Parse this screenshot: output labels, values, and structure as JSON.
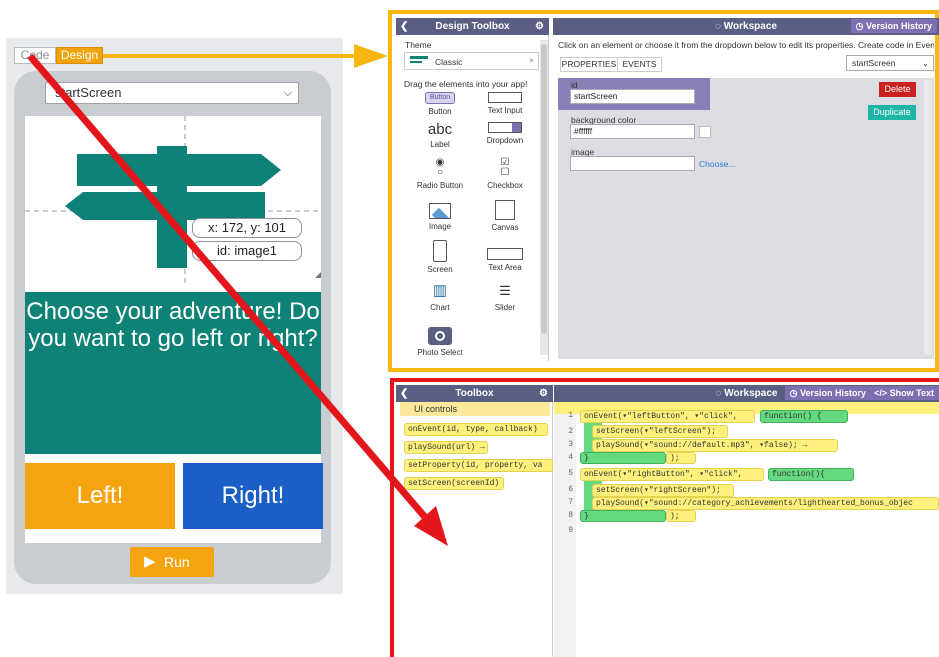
{
  "left": {
    "code_tab": "Code",
    "design_tab": "Design",
    "screen_select": "startScreen",
    "coord_readout": "x: 172, y: 101",
    "id_readout": "id: image1",
    "label_text": "Choose your adventure! Do you want to go left or right?",
    "left_button": "Left!",
    "right_button": "Right!",
    "run_button": "Run"
  },
  "design": {
    "toolbox_title": "Design Toolbox",
    "workspace_title": "Workspace",
    "version_history": "Version History",
    "theme_label": "Theme",
    "theme_value": "Classic",
    "drag_hint": "Drag the elements into your app!",
    "palette": [
      {
        "label": "Button",
        "icon": "button-icon"
      },
      {
        "label": "Text Input",
        "icon": "text-input-icon"
      },
      {
        "label": "Label",
        "icon": "label-icon"
      },
      {
        "label": "Dropdown",
        "icon": "dropdown-icon"
      },
      {
        "label": "Radio Button",
        "icon": "radio-icon"
      },
      {
        "label": "Checkbox",
        "icon": "checkbox-icon"
      },
      {
        "label": "Image",
        "icon": "image-icon"
      },
      {
        "label": "Canvas",
        "icon": "canvas-icon"
      },
      {
        "label": "Screen",
        "icon": "screen-icon"
      },
      {
        "label": "Text Area",
        "icon": "text-area-icon"
      },
      {
        "label": "Chart",
        "icon": "chart-icon"
      },
      {
        "label": "Slider",
        "icon": "slider-icon"
      },
      {
        "label": "Photo Select",
        "icon": "camera-icon"
      }
    ],
    "button_chip": "Button",
    "label_glyph": "abc",
    "instructions": "Click on an element or choose it from the dropdown below to edit its properties. Create code in Even...",
    "tab_properties": "PROPERTIES",
    "tab_events": "EVENTS",
    "element_select": "startScreen",
    "id_label": "id",
    "id_value": "startScreen",
    "bg_label": "background color",
    "bg_value": "#ffffff",
    "image_label": "image",
    "choose_link": "Choose...",
    "delete_button": "Delete",
    "duplicate_button": "Duplicate"
  },
  "code": {
    "toolbox_title": "Toolbox",
    "workspace_title": "Workspace",
    "version_history": "Version History",
    "show_text": "Show Text",
    "category": "UI controls",
    "blocks": [
      "onEvent(id, type, callback)",
      "playSound(url) →",
      "setProperty(id, property, va",
      "setScreen(screenId)"
    ],
    "line_numbers": [
      "1",
      "2",
      "3",
      "4",
      "5",
      "6",
      "7",
      "8",
      "9"
    ],
    "lines": {
      "l1a": "onEvent(▾\"leftButton\", ▾\"click\",",
      "l1b": "function() {",
      "l2": "setScreen(▾\"leftScreen\");",
      "l3": "playSound(▾\"sound://default.mp3\", ▾false); →",
      "l4a": "}",
      "l4b": ");",
      "l5a": "onEvent(▾\"rightButton\", ▾\"click\",",
      "l5b": "function(){",
      "l6": "setScreen(▾\"rightScreen\");",
      "l7": "playSound(▾\"sound://category_achievements/lighthearted_bonus_objec",
      "l8a": "}",
      "l8b": ");"
    }
  },
  "colors": {
    "accent_orange": "#f6b810",
    "annotation_red": "#e3161c",
    "teal": "#0e8277",
    "blue": "#1a5fc5",
    "header_purple": "#5b5e83"
  }
}
